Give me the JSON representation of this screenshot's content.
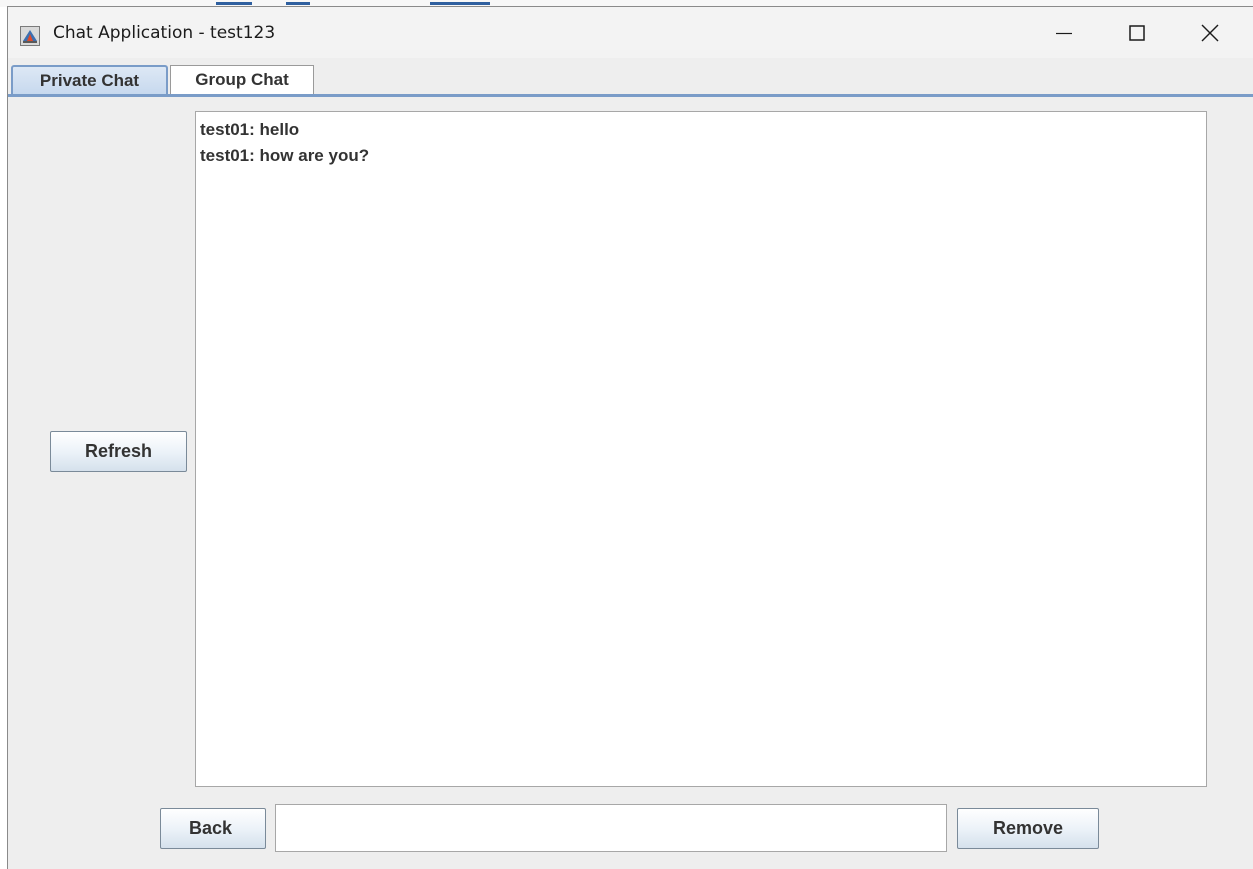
{
  "window": {
    "title": "Chat Application - test123",
    "controls": {
      "minimize_icon": "minimize-icon",
      "maximize_icon": "maximize-icon",
      "close_icon": "close-icon"
    }
  },
  "tabs": [
    {
      "label": "Private Chat",
      "selected": true
    },
    {
      "label": "Group Chat",
      "selected": false
    }
  ],
  "chat": {
    "messages": [
      "test01: hello",
      "test01: how are you?"
    ]
  },
  "buttons": {
    "refresh": "Refresh",
    "back": "Back",
    "remove": "Remove"
  },
  "input": {
    "value": "",
    "placeholder": ""
  },
  "colors": {
    "selected_tab_border": "#7a9cc8",
    "window_background": "#eeeeee"
  }
}
